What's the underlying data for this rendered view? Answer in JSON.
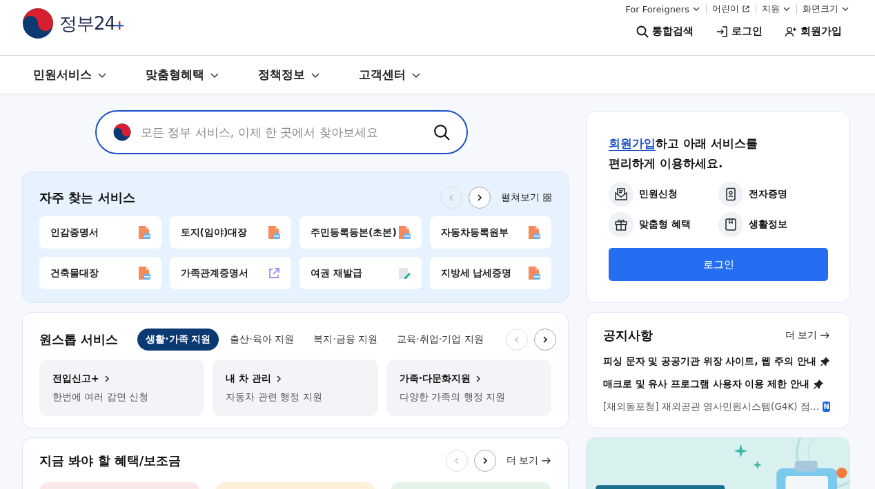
{
  "logo": {
    "text": "정부24"
  },
  "util_links": [
    {
      "label": "For Foreigners",
      "kind": "dropdown"
    },
    {
      "label": "어린이",
      "kind": "external"
    },
    {
      "label": "지원",
      "kind": "dropdown"
    },
    {
      "label": "화면크기",
      "kind": "dropdown"
    }
  ],
  "header_actions": [
    {
      "label": "통합검색",
      "kind": "search"
    },
    {
      "label": "로그인",
      "kind": "login"
    },
    {
      "label": "회원가입",
      "kind": "signup"
    }
  ],
  "nav": [
    "민원서비스",
    "맞춤형혜택",
    "정책정보",
    "고객센터"
  ],
  "search": {
    "placeholder": "모든 정부 서비스, 이제 한 곳에서 찾아보세요"
  },
  "frequent": {
    "title": "자주 찾는 서비스",
    "expand": "펼쳐보기",
    "items": [
      {
        "label": "인감증명서",
        "kind": "pdf"
      },
      {
        "label": "토지(임야)대장",
        "kind": "pdf"
      },
      {
        "label": "주민등록등본(초본)",
        "kind": "pdf"
      },
      {
        "label": "자동차등록원부",
        "kind": "pdf"
      },
      {
        "label": "건축물대장",
        "kind": "pdf"
      },
      {
        "label": "가족관계증명서",
        "kind": "link"
      },
      {
        "label": "여권 재발급",
        "kind": "edit"
      },
      {
        "label": "지방세 납세증명",
        "kind": "pdf"
      }
    ]
  },
  "oneshop": {
    "title": "원스톱 서비스",
    "tabs": [
      {
        "label": "생활·가족 지원",
        "selected": true
      },
      {
        "label": "출산·육아 지원",
        "selected": false
      },
      {
        "label": "복지·금융 지원",
        "selected": false
      },
      {
        "label": "교육·취업·기업 지원",
        "selected": false
      }
    ],
    "cards": [
      {
        "title": "전입신고+",
        "desc": "한번에 여러 감면 신청"
      },
      {
        "title": "내 차 관리",
        "desc": "자동차 관련 행정 지원"
      },
      {
        "title": "가족·다문화지원",
        "desc": "다양한 가족의 행정 지원"
      }
    ]
  },
  "benefits": {
    "title": "지금 봐야 할 혜택/보조금",
    "more": "더 보기"
  },
  "login_card": {
    "link": "회원가입",
    "text": "하고 아래 서비스를\n편리하게 이용하세요.",
    "services": [
      {
        "label": "민원신청",
        "kind": "petition"
      },
      {
        "label": "전자증명",
        "kind": "certificate"
      },
      {
        "label": "맞춤형 혜택",
        "kind": "benefit"
      },
      {
        "label": "생활정보",
        "kind": "info"
      }
    ],
    "button": "로그인"
  },
  "notices": {
    "title": "공지사항",
    "more": "더 보기",
    "items": [
      {
        "text": "피싱 문자 및 공공기관 위장 사이트, 웹 주의 안내",
        "kind": "pinned"
      },
      {
        "text": "매크로 및 유사 프로그램 사용자 이용 제한 안내",
        "kind": "pinned"
      },
      {
        "text": "[재외동포청] 재외공관 영사민원시스템(G4K) 점…",
        "kind": "new",
        "badge": "N"
      }
    ]
  }
}
